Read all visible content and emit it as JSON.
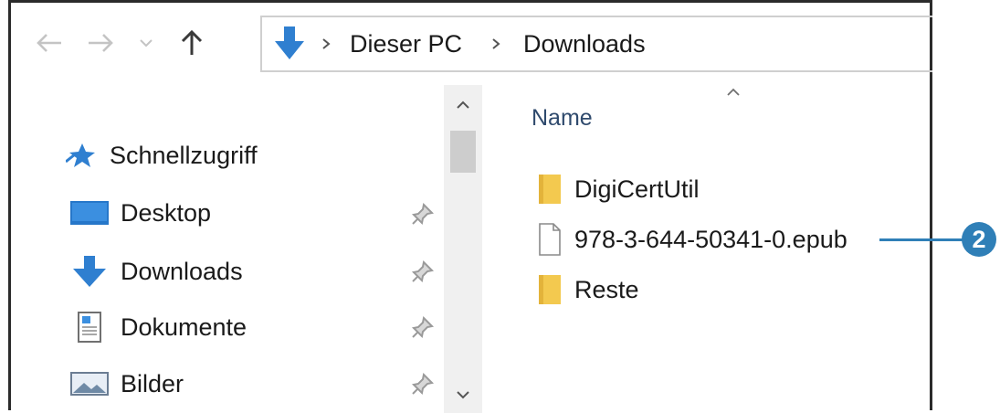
{
  "nav": {
    "icons": [
      "arrow-left-icon",
      "arrow-right-icon",
      "chevron-down-icon",
      "arrow-up-icon"
    ]
  },
  "address": {
    "crumbs": [
      "Dieser PC",
      "Downloads"
    ],
    "icon": "download-arrow-icon"
  },
  "sidebar": {
    "items": [
      {
        "label": "Schnellzugriff",
        "icon": "star-icon",
        "pinned": false
      },
      {
        "label": "Desktop",
        "icon": "desktop-icon",
        "pinned": true
      },
      {
        "label": "Downloads",
        "icon": "download-arrow-icon",
        "pinned": true
      },
      {
        "label": "Dokumente",
        "icon": "document-icon",
        "pinned": true
      },
      {
        "label": "Bilder",
        "icon": "pictures-icon",
        "pinned": true
      }
    ]
  },
  "content": {
    "column_header": "Name",
    "files": [
      {
        "label": "DigiCertUtil",
        "type": "folder"
      },
      {
        "label": "978-3-644-50341-0.epub",
        "type": "file"
      },
      {
        "label": "Reste",
        "type": "folder"
      }
    ]
  },
  "callout": {
    "number": "2"
  },
  "colors": {
    "accent": "#2f7fb7",
    "folder": "#f3c94f",
    "border": "#2b2b2b"
  }
}
